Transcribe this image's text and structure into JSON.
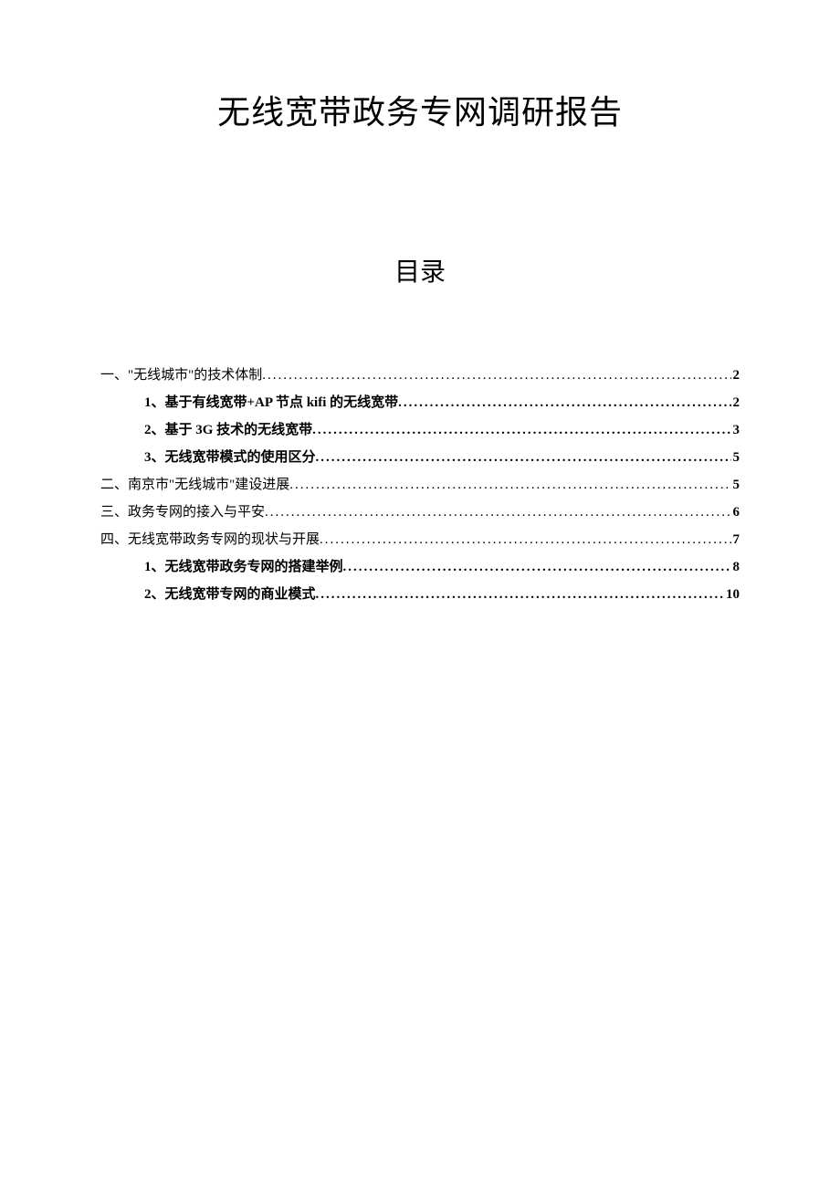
{
  "title": "无线宽带政务专网调研报告",
  "toc_title": "目录",
  "toc": [
    {
      "level": 1,
      "label": "一、\"无线城市\"的技术体制",
      "page": "2"
    },
    {
      "level": 2,
      "label": "1、基于有线宽带+AP 节点 kifi 的无线宽带",
      "page": "2"
    },
    {
      "level": 2,
      "label": "2、基于 3G 技术的无线宽带",
      "page": "3"
    },
    {
      "level": 2,
      "label": "3、无线宽带模式的使用区分",
      "page": "5"
    },
    {
      "level": 1,
      "label": "二、南京市\"无线城市\"建设进展",
      "page": "5"
    },
    {
      "level": 1,
      "label": "三、政务专网的接入与平安",
      "page": "6"
    },
    {
      "level": 1,
      "label": "四、无线宽带政务专网的现状与开展",
      "page": "7"
    },
    {
      "level": 2,
      "label": "1、无线宽带政务专网的搭建举例",
      "page": "8"
    },
    {
      "level": 2,
      "label": "2、无线宽带专网的商业模式",
      "page": "10"
    }
  ]
}
